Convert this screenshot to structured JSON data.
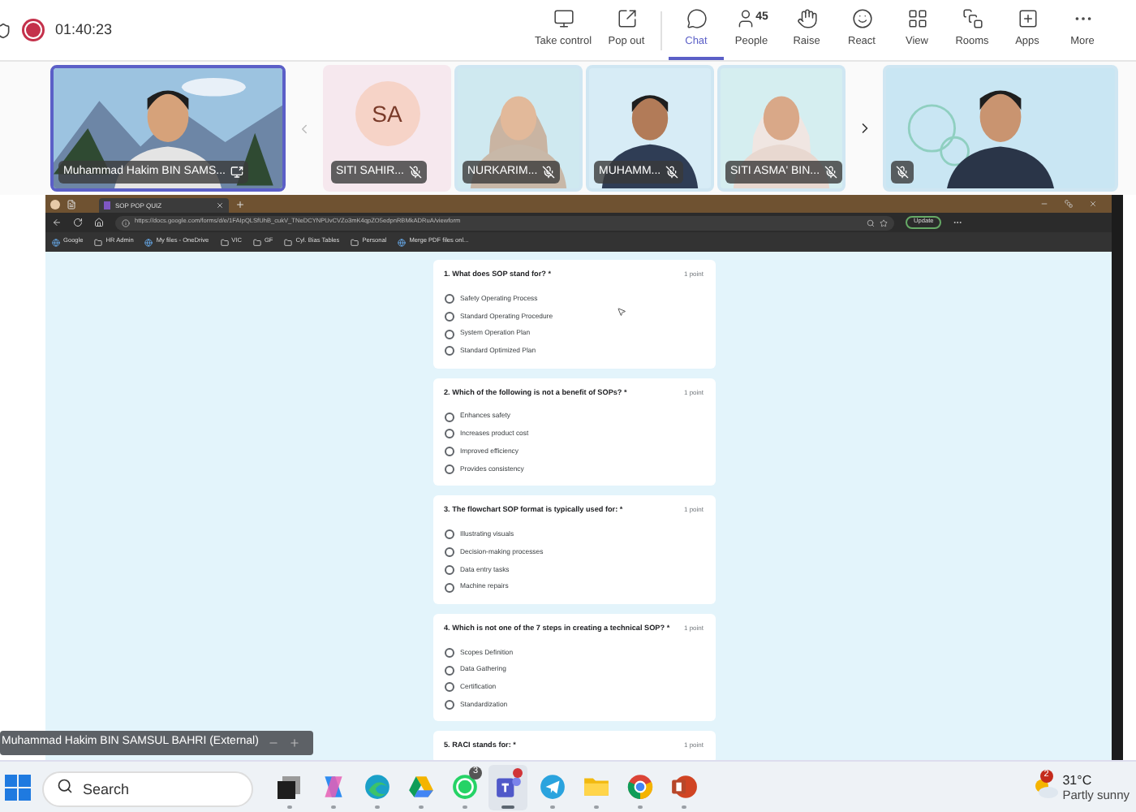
{
  "meeting": {
    "recording": true,
    "timer": "01:40:23"
  },
  "toolbar": [
    {
      "label": "Take control",
      "selected": false
    },
    {
      "label": "Pop out",
      "selected": false
    },
    {
      "label": "Chat",
      "selected": true
    },
    {
      "label": "People",
      "selected": false,
      "count": "45"
    },
    {
      "label": "Raise",
      "selected": false
    },
    {
      "label": "React",
      "selected": false
    },
    {
      "label": "View",
      "selected": false
    },
    {
      "label": "Rooms",
      "selected": false
    },
    {
      "label": "Apps",
      "selected": false
    },
    {
      "label": "More",
      "selected": false
    }
  ],
  "participants": [
    {
      "kind": "video",
      "name": "Muhammad Hakim BIN SAMS...",
      "muted": false,
      "selected": true
    },
    {
      "kind": "avatar",
      "initials": "SA",
      "name": "SITI SAHIR...",
      "muted": true,
      "selected": false
    },
    {
      "kind": "video",
      "name": "NURKARIM...",
      "muted": true,
      "selected": false
    },
    {
      "kind": "video",
      "name": "MUHAMM...",
      "muted": true,
      "selected": false
    },
    {
      "kind": "video",
      "name": "SITI ASMA' BIN...",
      "muted": true,
      "selected": false
    },
    {
      "kind": "video",
      "muted": true,
      "selected": false
    }
  ],
  "browser": {
    "tab_title": "SOP POP QUIZ",
    "url": "https://docs.google.com/forms/d/e/1FAIpQLSfUhB_cukV_TNeDCYNPUvCVZo3mK4qpZO5edpnRBMkADRuA/viewform",
    "update_label": "Update",
    "bookmarks": [
      {
        "label": "Google",
        "kind": "site"
      },
      {
        "label": "HR Admin",
        "kind": "folder"
      },
      {
        "label": "My files - OneDrive",
        "kind": "site"
      },
      {
        "label": "VIC",
        "kind": "folder"
      },
      {
        "label": "GF",
        "kind": "folder"
      },
      {
        "label": "Cyl. Bias Tables",
        "kind": "folder"
      },
      {
        "label": "Personal",
        "kind": "folder"
      },
      {
        "label": "Merge PDF files onl...",
        "kind": "site"
      }
    ]
  },
  "form": {
    "questions": [
      {
        "title": "1. What does SOP stand for? *",
        "points": "1 point",
        "options": [
          {
            "label": "Safety Operating Process",
            "selected": false
          },
          {
            "label": "Standard Operating Procedure",
            "selected": false
          },
          {
            "label": "System Operation Plan",
            "selected": false
          },
          {
            "label": "Standard Optimized Plan",
            "selected": false
          }
        ]
      },
      {
        "title": "2. Which of the following is not a benefit of SOPs? *",
        "points": "1 point",
        "options": [
          {
            "label": "Enhances safety",
            "selected": false
          },
          {
            "label": "Increases product cost",
            "selected": false
          },
          {
            "label": "Improved efficiency",
            "selected": false
          },
          {
            "label": "Provides consistency",
            "selected": false
          }
        ]
      },
      {
        "title": "3. The flowchart SOP format is typically used for: *",
        "points": "1 point",
        "options": [
          {
            "label": "Illustrating visuals",
            "selected": false
          },
          {
            "label": "Decision-making processes",
            "selected": false
          },
          {
            "label": "Data entry tasks",
            "selected": false
          },
          {
            "label": "Machine repairs",
            "selected": false
          }
        ]
      },
      {
        "title": "4. Which is not one of the 7 steps in creating a technical SOP? *",
        "points": "1 point",
        "options": [
          {
            "label": "Scopes Definition",
            "selected": false
          },
          {
            "label": "Data Gathering",
            "selected": false
          },
          {
            "label": "Certification",
            "selected": false
          },
          {
            "label": "Standardization",
            "selected": false
          }
        ]
      },
      {
        "title": "5. RACI stands for: *",
        "points": "1 point"
      }
    ]
  },
  "presenter_label": "Muhammad Hakim BIN SAMSUL BAHRI (External)",
  "taskbar": {
    "search_placeholder": "Search",
    "apps": [
      {
        "kind": "taskview",
        "active": false
      },
      {
        "kind": "copilot",
        "active": false
      },
      {
        "kind": "edge",
        "active": false
      },
      {
        "kind": "drive",
        "active": false
      },
      {
        "kind": "whatsapp",
        "active": false,
        "badge": "3"
      },
      {
        "kind": "teams",
        "active": true
      },
      {
        "kind": "telegram",
        "active": false
      },
      {
        "kind": "files",
        "active": false
      },
      {
        "kind": "chrome",
        "active": false
      },
      {
        "kind": "powerpoint",
        "active": false
      }
    ],
    "weather": {
      "temperature": "31°C",
      "condition": "Partly sunny",
      "badge": "2"
    }
  }
}
